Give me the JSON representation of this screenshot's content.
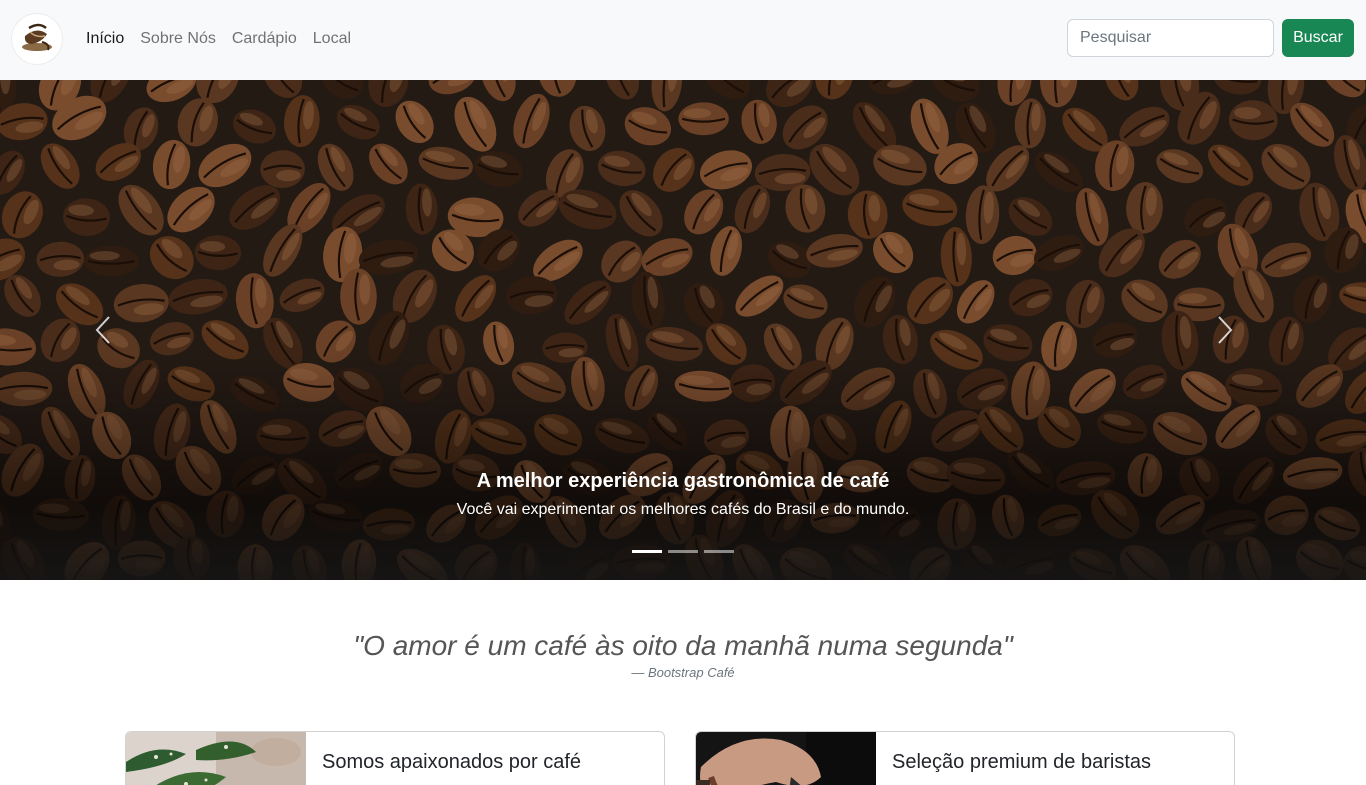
{
  "navbar": {
    "brand_icon": "coffee-logo",
    "links": [
      {
        "label": "Início",
        "active": true
      },
      {
        "label": "Sobre Nós",
        "active": false
      },
      {
        "label": "Cardápio",
        "active": false
      },
      {
        "label": "Local",
        "active": false
      }
    ],
    "search": {
      "placeholder": "Pesquisar",
      "value": ""
    },
    "search_button": "Buscar",
    "search_button_color": "#198754"
  },
  "carousel": {
    "caption_title": "A melhor experiência gastronômica de café",
    "caption_text": "Você vai experimentar os melhores cafés do Brasil e do mundo.",
    "slide_count": 3,
    "active_slide": 1,
    "prev_icon": "chevron-left-icon",
    "next_icon": "chevron-right-icon"
  },
  "quote": {
    "text": "\"O amor é um café às oito da manhã numa segunda\"",
    "author": "—  Bootstrap Café"
  },
  "cards": [
    {
      "title": "Somos apaixonados por café",
      "image": "plant-photo"
    },
    {
      "title": "Seleção premium de baristas",
      "image": "barista-hand-photo"
    }
  ]
}
